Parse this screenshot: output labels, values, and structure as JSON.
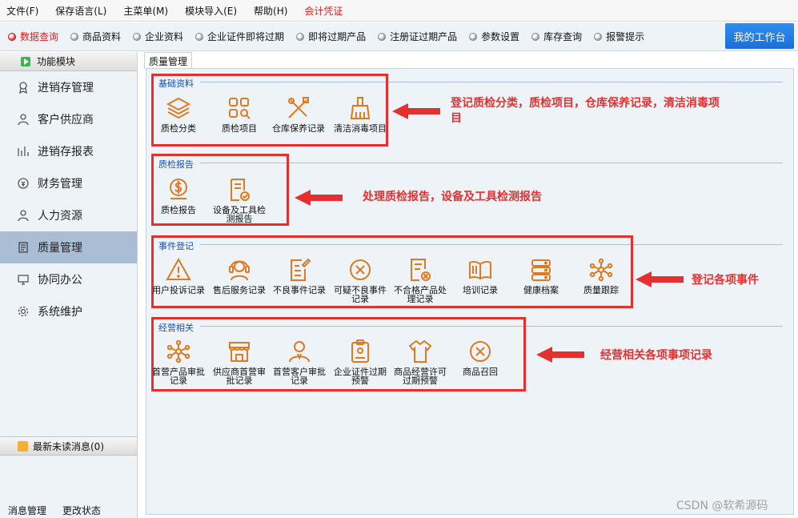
{
  "menu": [
    "文件(F)",
    "保存语言(L)",
    "主菜单(M)",
    "模块导入(E)",
    "帮助(H)",
    "会计凭证"
  ],
  "quickbar": [
    "数据查询",
    "商品资料",
    "企业资料",
    "企业证件即将过期",
    "即将过期产品",
    "注册证过期产品",
    "参数设置",
    "库存查询",
    "报警提示"
  ],
  "workbench": "我的工作台",
  "sidebar": {
    "header": "功能模块",
    "items": [
      "进销存管理",
      "客户供应商",
      "进销存报表",
      "财务管理",
      "人力资源",
      "质量管理",
      "协同办公",
      "系统维护"
    ],
    "messages": "最新未读消息(0)",
    "footer": [
      "消息管理",
      "更改状态"
    ]
  },
  "tab": "质量管理",
  "sections": [
    {
      "title": "基础资料",
      "items": [
        "质检分类",
        "质检项目",
        "仓库保养记录",
        "清洁消毒项目"
      ],
      "icons": [
        "layers-icon",
        "grid-search-icon",
        "tools-icon",
        "broom-icon"
      ]
    },
    {
      "title": "质检报告",
      "items": [
        "质检报告",
        "设备及工具检测报告"
      ],
      "icons": [
        "dollar-report-icon",
        "doc-check-icon"
      ]
    },
    {
      "title": "事件登记",
      "items": [
        "用户投诉记录",
        "售后服务记录",
        "不良事件记录",
        "可疑不良事件记录",
        "不合格产品处理记录",
        "培训记录",
        "健康档案",
        "质量跟踪"
      ],
      "icons": [
        "warning-icon",
        "headset-icon",
        "edit-doc-icon",
        "x-circle-icon",
        "doc-x-icon",
        "book-icon",
        "stack-icon",
        "network-icon"
      ]
    },
    {
      "title": "经营相关",
      "items": [
        "首营产品审批记录",
        "供应商首营审批记录",
        "首营客户审批记录",
        "企业证件过期预警",
        "商品经营许可过期预警",
        "商品召回"
      ],
      "icons": [
        "network-icon",
        "shop-icon",
        "user-icon",
        "clipboard-icon",
        "shirt-icon",
        "x-circle-icon"
      ]
    }
  ],
  "notes": [
    "登记质检分类，质检项目，仓库保养记录，清洁消毒项目",
    "处理质检报告，设备及工具检测报告",
    "登记各项事件",
    "经营相关各项事项记录"
  ],
  "watermark": "CSDN @软希源码",
  "colors": {
    "icon": "#e07a20",
    "annotation": "#e63030",
    "section_title": "#1b4fb3",
    "accent": "#1b6fd6"
  }
}
